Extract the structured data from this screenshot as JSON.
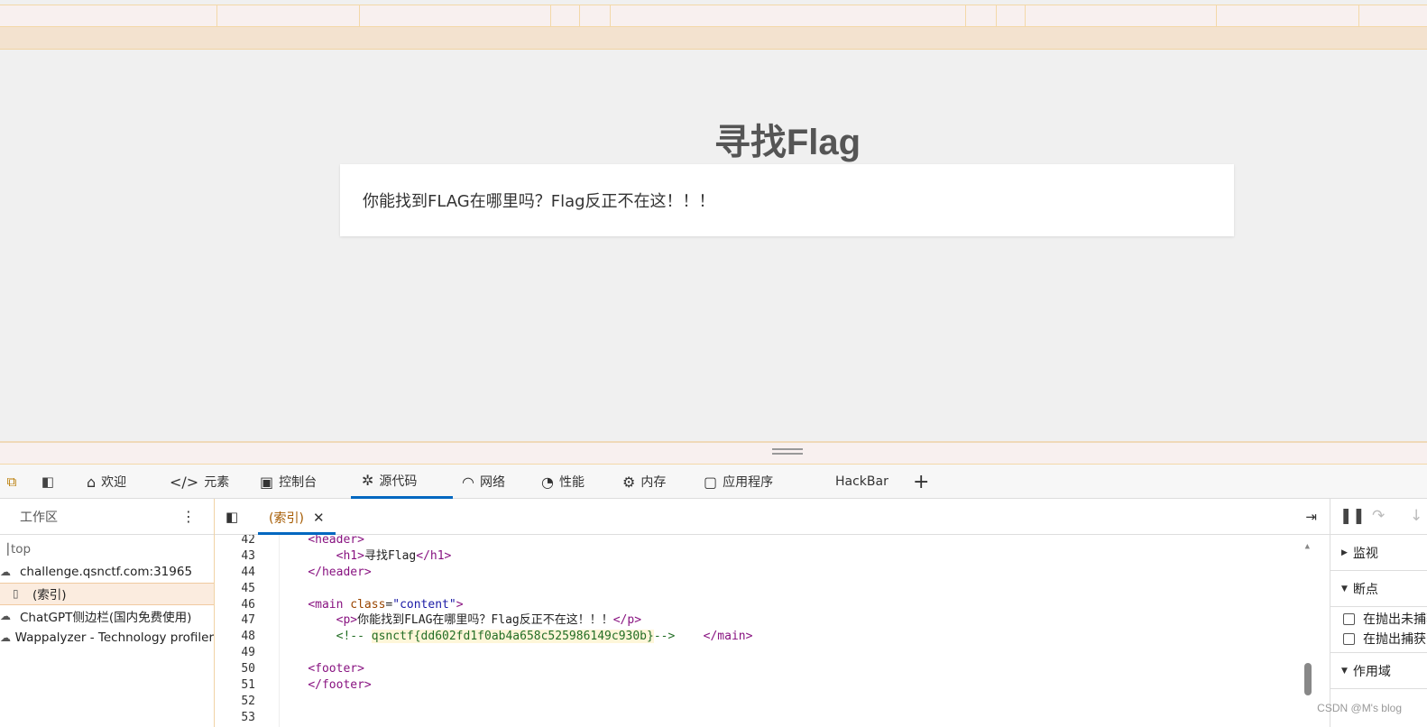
{
  "page": {
    "heading": "寻找Flag",
    "content_text": "你能找到FLAG在哪里吗？Flag反正不在这！！！"
  },
  "devtools": {
    "tabs": [
      {
        "label": "欢迎",
        "icon": "home-icon"
      },
      {
        "label": "元素",
        "icon": "code-icon"
      },
      {
        "label": "控制台",
        "icon": "terminal-icon"
      },
      {
        "label": "源代码",
        "icon": "bug-icon",
        "active": true
      },
      {
        "label": "网络",
        "icon": "wifi-icon"
      },
      {
        "label": "性能",
        "icon": "gauge-icon"
      },
      {
        "label": "内存",
        "icon": "chip-icon"
      },
      {
        "label": "应用程序",
        "icon": "app-window-icon"
      },
      {
        "label": "HackBar"
      }
    ],
    "add_tab_label": "+",
    "accent": "#0067c0"
  },
  "sources": {
    "workspace_label": "工作区",
    "tree": {
      "top": "top",
      "origin": "challenge.qsnctf.com:31965",
      "index_file": "(索引)",
      "ext1": "ChatGPT侧边栏(国内免费使用)",
      "ext2": "Wappalyzer - Technology profiler"
    },
    "open_file_tab": "(索引)"
  },
  "code": {
    "line_numbers": [
      "42",
      "43",
      "44",
      "45",
      "46",
      "47",
      "48",
      "49",
      "50",
      "51",
      "52",
      "53"
    ],
    "l42_tag": "<header>",
    "l43_open": "<h1>",
    "l43_text": "寻找Flag",
    "l43_close": "</h1>",
    "l44_tag": "</header>",
    "l46_open": "<main ",
    "l46_attr": "class",
    "l46_eq": "=",
    "l46_val": "\"content\"",
    "l46_close": ">",
    "l47_open": "<p>",
    "l47_text": "你能找到FLAG在哪里吗？Flag反正不在这！！！",
    "l47_close": "</p>",
    "l48_comment_open": "<!-- ",
    "l48_comment_body": "qsnctf{dd602fd1f0ab4a658c525986149c930b}",
    "l48_comment_close": "-->",
    "l48_main_close": "</main>",
    "l50_tag": "<footer>",
    "l51_tag": "</footer>"
  },
  "debugger": {
    "watch_label": "监视",
    "breakpoints_label": "断点",
    "uncaught_label": "在抛出未捕获的异常时暂停",
    "caught_label": "在抛出捕获的异常时暂停",
    "scope_label": "作用域"
  },
  "watermark": "CSDN @M's blog"
}
